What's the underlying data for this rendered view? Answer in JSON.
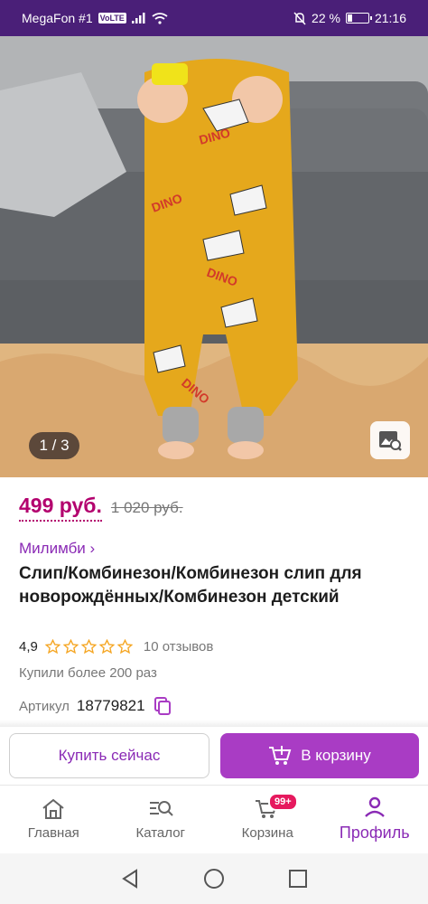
{
  "status_bar": {
    "carrier": "MegaFon #1",
    "volte": "VoLTE",
    "battery_text": "22 %",
    "battery_level": 0.22,
    "time": "21:16",
    "icons": [
      "signal-icon",
      "wifi-icon",
      "mute-bell-icon",
      "battery-icon"
    ]
  },
  "gallery": {
    "counter": "1 / 3",
    "visual_search_icon": "image-search-icon"
  },
  "product": {
    "price": "499 руб.",
    "old_price": "1 020 руб.",
    "brand": "Милимби ›",
    "title": "Слип/Комбинезон/Комбинезон слип для новорождённых/Комбинезон детский",
    "rating": "4,9",
    "stars": 5,
    "reviews": "10 отзывов",
    "bought": "Купили более 200 раз",
    "article_label": "Артикул",
    "article_value": "18779821"
  },
  "actions": {
    "buy_now": "Купить сейчас",
    "add_to_cart": "В корзину"
  },
  "tabs": [
    {
      "label": "Главная",
      "icon": "home-icon"
    },
    {
      "label": "Каталог",
      "icon": "catalog-search-icon"
    },
    {
      "label": "Корзина",
      "icon": "cart-icon",
      "badge": "99+"
    },
    {
      "label": "Профиль",
      "icon": "profile-icon",
      "active": true
    }
  ],
  "colors": {
    "accent": "#a93cc4",
    "price": "#b3006e",
    "status_bar": "#4a1f78",
    "badge": "#e6195e",
    "star": "#f5a623"
  }
}
